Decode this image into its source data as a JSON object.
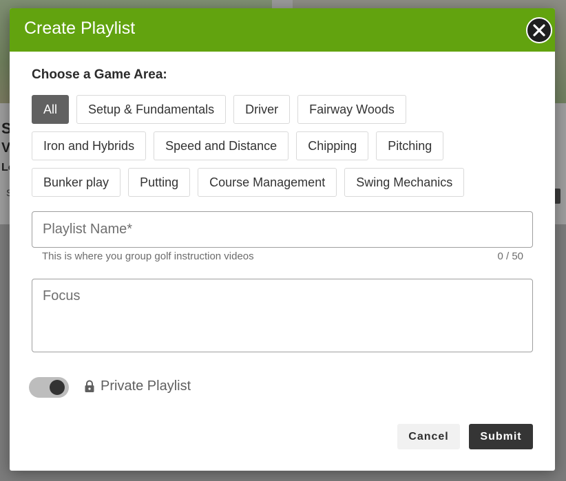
{
  "background": {
    "letters": [
      "S",
      "V",
      "Lo",
      "S"
    ]
  },
  "modal": {
    "title": "Create Playlist",
    "section_label": "Choose a Game Area:",
    "game_areas": [
      [
        "All",
        "Setup & Fundamentals",
        "Driver",
        "Fairway Woods"
      ],
      [
        "Iron and Hybrids",
        "Speed and Distance",
        "Chipping",
        "Pitching"
      ],
      [
        "Bunker play",
        "Putting",
        "Course Management",
        "Swing Mechanics"
      ]
    ],
    "selected_area": "All",
    "playlist_name": {
      "value": "",
      "placeholder": "Playlist Name*",
      "hint": "This is where you group golf instruction videos",
      "counter": "0 / 50"
    },
    "focus": {
      "value": "",
      "placeholder": "Focus"
    },
    "private_toggle": {
      "label": "Private Playlist",
      "on": true
    },
    "buttons": {
      "cancel": "Cancel",
      "submit": "Submit"
    }
  },
  "colors": {
    "header": "#62a30f",
    "chip_selected": "#616161",
    "submit": "#353535"
  },
  "icons": {
    "close": "close-icon",
    "lock": "lock-icon"
  }
}
